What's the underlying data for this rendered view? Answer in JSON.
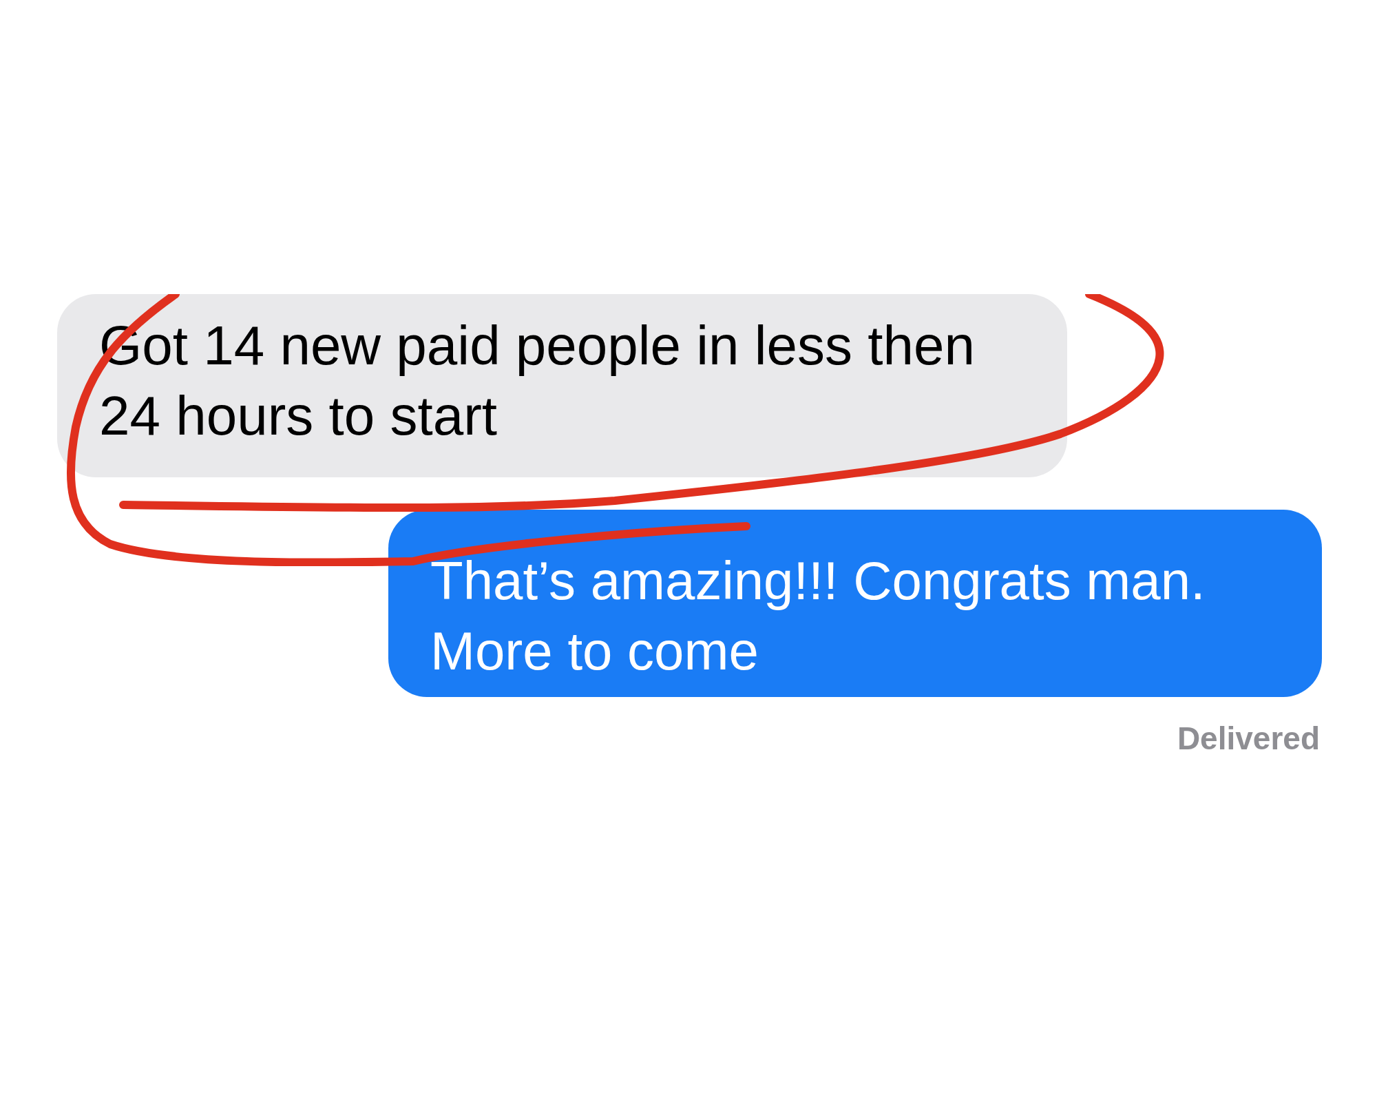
{
  "messages": [
    {
      "kind": "received",
      "text": "Got 14 new paid people in less then 24 hours to start"
    },
    {
      "kind": "sent",
      "text": "That’s amazing!!! Congrats man. More to come"
    }
  ],
  "status": "Delivered"
}
